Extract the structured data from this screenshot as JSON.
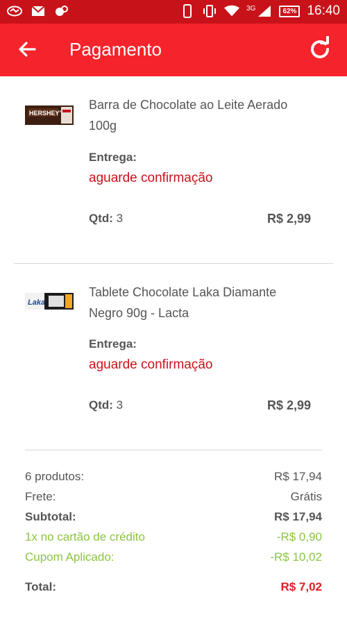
{
  "statusbar": {
    "network": "3G",
    "battery": "62%",
    "time": "16:40"
  },
  "appbar": {
    "title": "Pagamento",
    "back_icon": "arrow-left-icon",
    "refresh_icon": "refresh-icon"
  },
  "items": [
    {
      "name": "Barra de Chocolate ao Leite Aerado 100g",
      "entrega_label": "Entrega:",
      "entrega_value": "aguarde confirmação",
      "qtd_label": "Qtd:",
      "qtd_value": "3",
      "price": "R$ 2,99"
    },
    {
      "name": "Tablete Chocolate Laka Diamante Negro 90g - Lacta",
      "entrega_label": "Entrega:",
      "entrega_value": "aguarde confirmação",
      "qtd_label": "Qtd:",
      "qtd_value": "3",
      "price": "R$ 2,99"
    }
  ],
  "summary": {
    "produtos_label": "6 produtos:",
    "produtos_value": "R$ 17,94",
    "frete_label": "Frete:",
    "frete_value": "Grátis",
    "subtotal_label": "Subtotal:",
    "subtotal_value": "R$ 17,94",
    "cartao_label": "1x no cartão de crédito",
    "cartao_value": "-R$ 0,90",
    "cupom_label": "Cupom Aplicado:",
    "cupom_value": "-R$ 10,02",
    "total_label": "Total:",
    "total_value": "R$ 7,02"
  },
  "colors": {
    "statusbar": "#c8121a",
    "appbar": "#f5232b",
    "delivery_text": "#c8121a",
    "discount_text": "#8bc43f",
    "total_text": "#e01b24"
  }
}
